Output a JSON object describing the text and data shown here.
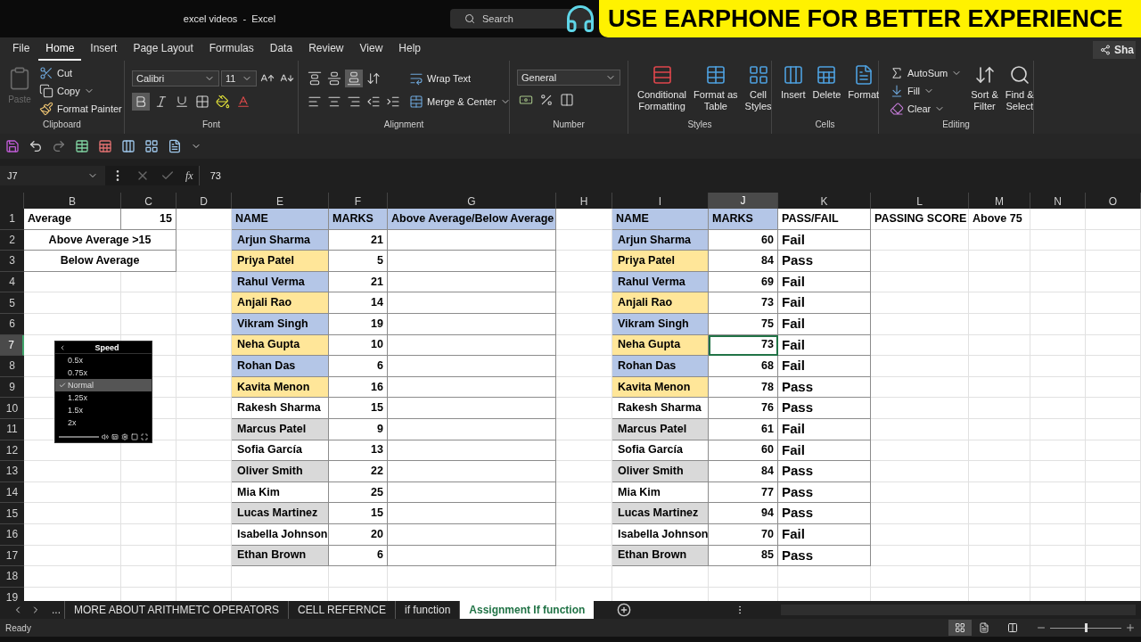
{
  "title_bar": {
    "title": "excel videos  -  Excel",
    "search_placeholder": "Search"
  },
  "banner": {
    "text": "USE EARPHONE FOR BETTER EXPERIENCE"
  },
  "menu_tabs": [
    {
      "label": "File",
      "selected": false
    },
    {
      "label": "Home",
      "selected": true
    },
    {
      "label": "Insert",
      "selected": false
    },
    {
      "label": "Page Layout",
      "selected": false
    },
    {
      "label": "Formulas",
      "selected": false
    },
    {
      "label": "Data",
      "selected": false
    },
    {
      "label": "Review",
      "selected": false
    },
    {
      "label": "View",
      "selected": false
    },
    {
      "label": "Help",
      "selected": false
    }
  ],
  "share_button": "Sha",
  "ribbon": {
    "clipboard": {
      "title": "Clipboard",
      "paste": {
        "label": "Paste",
        "disabled": true
      },
      "cut": "Cut",
      "copy": "Copy",
      "format_painter": "Format Painter"
    },
    "font": {
      "title": "Font",
      "font_name": "Calibri",
      "font_size": "11",
      "bold_selected": true
    },
    "alignment": {
      "title": "Alignment",
      "bottom_align_selected": true,
      "wrap_text": "Wrap Text",
      "merge_center": "Merge & Center"
    },
    "number": {
      "title": "Number",
      "format": "General"
    },
    "styles": {
      "title": "Styles",
      "conditional_formatting": "Conditional\nFormatting",
      "format_as_table": "Format as\nTable",
      "cell_styles": "Cell\nStyles"
    },
    "cells": {
      "title": "Cells",
      "insert": "Insert",
      "delete": "Delete",
      "format": "Format"
    },
    "editing": {
      "title": "Editing",
      "autosum": "AutoSum",
      "fill": "Fill",
      "clear": "Clear",
      "sort_filter": "Sort &\nFilter",
      "find_select": "Find &\nSelect"
    }
  },
  "formula_bar": {
    "name_box": "J7",
    "function_label": "fx",
    "formula": "73"
  },
  "columns": [
    {
      "label": "B",
      "selected": false
    },
    {
      "label": "C",
      "selected": false
    },
    {
      "label": "D",
      "selected": false
    },
    {
      "label": "E",
      "selected": false
    },
    {
      "label": "F",
      "selected": false
    },
    {
      "label": "G",
      "selected": false
    },
    {
      "label": "H",
      "selected": false
    },
    {
      "label": "I",
      "selected": false
    },
    {
      "label": "J",
      "selected": true
    },
    {
      "label": "K",
      "selected": false
    },
    {
      "label": "L",
      "selected": false
    },
    {
      "label": "M",
      "selected": false
    },
    {
      "label": "N",
      "selected": false
    },
    {
      "label": "O",
      "selected": false
    }
  ],
  "row_headers": [
    {
      "label": "1",
      "selected": false
    },
    {
      "label": "2",
      "selected": false
    },
    {
      "label": "3",
      "selected": false
    },
    {
      "label": "4",
      "selected": false
    },
    {
      "label": "5",
      "selected": false
    },
    {
      "label": "6",
      "selected": false
    },
    {
      "label": "7",
      "selected": true
    },
    {
      "label": "8",
      "selected": false
    },
    {
      "label": "9",
      "selected": false
    },
    {
      "label": "10",
      "selected": false
    },
    {
      "label": "11",
      "selected": false
    },
    {
      "label": "12",
      "selected": false
    },
    {
      "label": "13",
      "selected": false
    },
    {
      "label": "14",
      "selected": false
    },
    {
      "label": "15",
      "selected": false
    },
    {
      "label": "16",
      "selected": false
    },
    {
      "label": "17",
      "selected": false
    },
    {
      "label": "18",
      "selected": false
    },
    {
      "label": "19",
      "selected": false
    }
  ],
  "summary": {
    "average_label": "Average",
    "average_value": "15",
    "above": "Above Average  >15",
    "below": "Below  Average"
  },
  "marks_table": {
    "headers": [
      {
        "text": "NAME",
        "color": "#b4c6e7"
      },
      {
        "text": "MARKS",
        "color": "#b4c6e7"
      },
      {
        "text": "Above Average/Below Average",
        "color": "#b4c6e7"
      }
    ],
    "rows": [
      {
        "name": "Arjun Sharma",
        "marks": "21",
        "color": "#b4c6e7"
      },
      {
        "name": "Priya Patel",
        "marks": "5",
        "color": "#ffe699"
      },
      {
        "name": "Rahul Verma",
        "marks": "21",
        "color": "#b4c6e7"
      },
      {
        "name": "Anjali Rao",
        "marks": "14",
        "color": "#ffe699"
      },
      {
        "name": "Vikram Singh",
        "marks": "19",
        "color": "#b4c6e7"
      },
      {
        "name": "Neha Gupta",
        "marks": "10",
        "color": "#ffe699"
      },
      {
        "name": "Rohan Das",
        "marks": "6",
        "color": "#b4c6e7"
      },
      {
        "name": "Kavita Menon",
        "marks": "16",
        "color": "#ffe699"
      },
      {
        "name": "Rakesh Sharma",
        "marks": "15",
        "color": "#ffffff"
      },
      {
        "name": "Marcus Patel",
        "marks": "9",
        "color": "#d9d9d9"
      },
      {
        "name": "Sofia García",
        "marks": "13",
        "color": "#ffffff"
      },
      {
        "name": "Oliver Smith",
        "marks": "22",
        "color": "#d9d9d9"
      },
      {
        "name": "Mia Kim",
        "marks": "25",
        "color": "#ffffff"
      },
      {
        "name": "Lucas Martinez",
        "marks": "15",
        "color": "#d9d9d9"
      },
      {
        "name": "Isabella Johnson",
        "marks": "20",
        "color": "#ffffff"
      },
      {
        "name": "Ethan Brown",
        "marks": "6",
        "color": "#d9d9d9"
      }
    ]
  },
  "pass_table": {
    "headers": [
      {
        "text": "NAME",
        "color": "#b4c6e7"
      },
      {
        "text": "MARKS",
        "color": "#b4c6e7"
      },
      {
        "text": "PASS/FAIL",
        "color": "#ffffff"
      }
    ],
    "rows": [
      {
        "name": "Arjun Sharma",
        "marks": "60",
        "result": "Fail",
        "color": "#b4c6e7",
        "selected": false
      },
      {
        "name": "Priya Patel",
        "marks": "84",
        "result": "Pass",
        "color": "#ffe699",
        "selected": false
      },
      {
        "name": "Rahul Verma",
        "marks": "69",
        "result": "Fail",
        "color": "#b4c6e7",
        "selected": false
      },
      {
        "name": "Anjali Rao",
        "marks": "73",
        "result": "Fail",
        "color": "#ffe699",
        "selected": false
      },
      {
        "name": "Vikram Singh",
        "marks": "75",
        "result": "Fail",
        "color": "#b4c6e7",
        "selected": false
      },
      {
        "name": "Neha Gupta",
        "marks": "73",
        "result": "Fail",
        "color": "#ffe699",
        "selected": true
      },
      {
        "name": "Rohan Das",
        "marks": "68",
        "result": "Fail",
        "color": "#b4c6e7",
        "selected": false
      },
      {
        "name": "Kavita Menon",
        "marks": "78",
        "result": "Pass",
        "color": "#ffe699",
        "selected": false
      },
      {
        "name": "Rakesh Sharma",
        "marks": "76",
        "result": "Pass",
        "color": "#ffffff",
        "selected": false
      },
      {
        "name": "Marcus Patel",
        "marks": "61",
        "result": "Fail",
        "color": "#d9d9d9",
        "selected": false
      },
      {
        "name": "Sofia García",
        "marks": "60",
        "result": "Fail",
        "color": "#ffffff",
        "selected": false
      },
      {
        "name": "Oliver Smith",
        "marks": "84",
        "result": "Pass",
        "color": "#d9d9d9",
        "selected": false
      },
      {
        "name": "Mia Kim",
        "marks": "77",
        "result": "Pass",
        "color": "#ffffff",
        "selected": false
      },
      {
        "name": "Lucas Martinez",
        "marks": "94",
        "result": "Pass",
        "color": "#d9d9d9",
        "selected": false
      },
      {
        "name": "Isabella Johnson",
        "marks": "70",
        "result": "Fail",
        "color": "#ffffff",
        "selected": false
      },
      {
        "name": "Ethan Brown",
        "marks": "85",
        "result": "Pass",
        "color": "#d9d9d9",
        "selected": false
      }
    ]
  },
  "passing_score": {
    "label": "PASSING SCORE",
    "value": "Above 75"
  },
  "speed_menu": {
    "title": "Speed",
    "options": [
      {
        "label": "0.5x",
        "selected": false
      },
      {
        "label": "0.75x",
        "selected": false
      },
      {
        "label": "Normal",
        "selected": true
      },
      {
        "label": "1.25x",
        "selected": false
      },
      {
        "label": "1.5x",
        "selected": false
      },
      {
        "label": "2x",
        "selected": false
      }
    ]
  },
  "sheet_tabs": {
    "more": "...",
    "tabs": [
      {
        "label": "MORE ABOUT ARITHMETC OPERATORS",
        "selected": false
      },
      {
        "label": "CELL REFERNCE",
        "selected": false
      },
      {
        "label": "if function",
        "selected": false
      },
      {
        "label": "Assignment If function",
        "selected": true
      }
    ]
  },
  "status_bar": {
    "status": "Ready",
    "zoom": {
      "level": 0.5
    }
  }
}
